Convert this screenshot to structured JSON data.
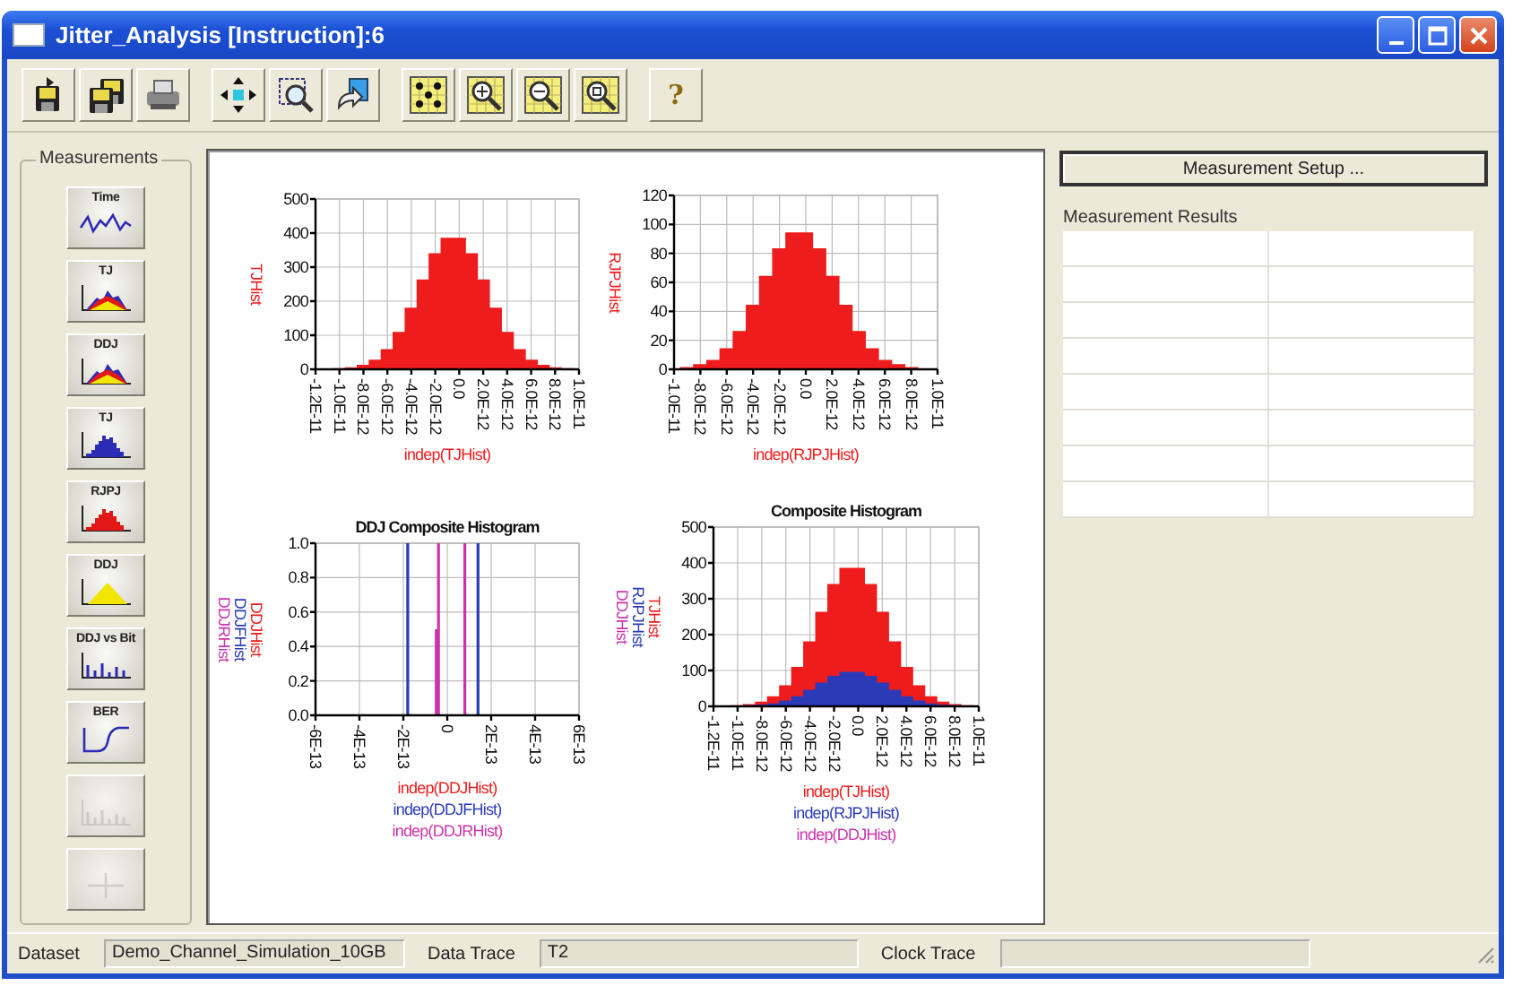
{
  "window": {
    "title": "Jitter_Analysis [Instruction]:6",
    "controls": [
      {
        "kind": "minimize"
      },
      {
        "kind": "maximize"
      },
      {
        "kind": "close"
      }
    ]
  },
  "toolbar": {
    "groups": [
      {
        "buttons": [
          {
            "kind": "save"
          },
          {
            "kind": "save-all"
          },
          {
            "kind": "print"
          }
        ]
      },
      {
        "buttons": [
          {
            "kind": "move"
          },
          {
            "kind": "zoom-box"
          },
          {
            "kind": "copy"
          }
        ]
      },
      {
        "buttons": [
          {
            "kind": "fit"
          },
          {
            "kind": "zoom-in"
          },
          {
            "kind": "zoom-out"
          },
          {
            "kind": "zoom-reset"
          }
        ]
      },
      {
        "buttons": [
          {
            "kind": "help",
            "glyph": "?"
          }
        ]
      }
    ]
  },
  "measurements": {
    "title": "Measurements",
    "buttons": [
      {
        "label": "Time",
        "kind": "waveform",
        "disabled": false
      },
      {
        "label": "TJ",
        "kind": "stacked-histogram",
        "disabled": false
      },
      {
        "label": "DDJ",
        "kind": "stacked-histogram",
        "disabled": false
      },
      {
        "label": "TJ",
        "kind": "histogram",
        "color": "#2b2bb5",
        "disabled": false
      },
      {
        "label": "RJPJ",
        "kind": "histogram",
        "color": "#e01818",
        "disabled": false
      },
      {
        "label": "DDJ",
        "kind": "triangle",
        "color": "#f2e600",
        "disabled": false
      },
      {
        "label": "DDJ vs Bit",
        "kind": "bit-bars",
        "disabled": false
      },
      {
        "label": "BER",
        "kind": "bathtub",
        "disabled": false
      },
      {
        "kind": "bit-bars",
        "disabled": true
      },
      {
        "kind": "plus",
        "disabled": true
      }
    ]
  },
  "charts": [
    {
      "chart_data": {
        "type": "area",
        "x": [
          -1.2e-11,
          -1.1e-11,
          -1e-11,
          -9e-12,
          -8e-12,
          -7e-12,
          -6e-12,
          -5e-12,
          -4e-12,
          -3e-12,
          -2e-12,
          -1e-12,
          0,
          1e-12,
          2e-12,
          3e-12,
          4e-12,
          5e-12,
          6e-12,
          7e-12,
          8e-12,
          9e-12,
          1e-11
        ],
        "grid": true,
        "xlabel": [
          "indep(TJHist)"
        ],
        "series": [
          {
            "name": "TJHist",
            "color": "#ee1c1c",
            "values": [
              0,
              0,
              1,
              4,
              11,
              26,
              57,
              108,
              179,
              262,
              339,
              384,
              384,
              339,
              262,
              179,
              108,
              57,
              26,
              11,
              4,
              1,
              0
            ]
          }
        ],
        "xlim": [
          -1.2e-11,
          1e-11
        ],
        "ylim": [
          0,
          500
        ],
        "yticks": [
          0,
          100,
          200,
          300,
          400,
          500
        ],
        "xticks": [
          {
            "value": -1.2e-11,
            "label": "-1.2E-11"
          },
          {
            "value": -1e-11,
            "label": "-1.0E-11"
          },
          {
            "value": -8e-12,
            "label": "-8.0E-12"
          },
          {
            "value": -6e-12,
            "label": "-6.0E-12"
          },
          {
            "value": -4e-12,
            "label": "-4.0E-12"
          },
          {
            "value": -2e-12,
            "label": "-2.0E-12"
          },
          {
            "value": 0,
            "label": "0.0"
          },
          {
            "value": 2e-12,
            "label": "2.0E-12"
          },
          {
            "value": 4e-12,
            "label": "4.0E-12"
          },
          {
            "value": 6e-12,
            "label": "6.0E-12"
          },
          {
            "value": 8e-12,
            "label": "8.0E-12"
          },
          {
            "value": 1e-11,
            "label": "1.0E-11"
          }
        ]
      }
    },
    {
      "chart_data": {
        "type": "area",
        "x": [
          -1e-11,
          -9e-12,
          -8e-12,
          -7e-12,
          -6e-12,
          -5e-12,
          -4e-12,
          -3e-12,
          -2e-12,
          -1e-12,
          0,
          1e-12,
          2e-12,
          3e-12,
          4e-12,
          5e-12,
          6e-12,
          7e-12,
          8e-12,
          9e-12,
          1e-11
        ],
        "grid": true,
        "xlabel": [
          "indep(RJPJHist)"
        ],
        "series": [
          {
            "name": "RJPJHist",
            "color": "#ee1c1c",
            "values": [
              0,
              1,
              3,
              6,
              14,
              26,
              44,
              64,
              83,
              94,
              94,
              83,
              64,
              44,
              26,
              14,
              6,
              3,
              1,
              0,
              0
            ]
          }
        ],
        "xlim": [
          -1e-11,
          1e-11
        ],
        "ylim": [
          0,
          120
        ],
        "yticks": [
          0,
          20,
          40,
          60,
          80,
          100,
          120
        ],
        "xticks": [
          {
            "value": -1e-11,
            "label": "-1.0E-11"
          },
          {
            "value": -8e-12,
            "label": "-8.0E-12"
          },
          {
            "value": -6e-12,
            "label": "-6.0E-12"
          },
          {
            "value": -4e-12,
            "label": "-4.0E-12"
          },
          {
            "value": -2e-12,
            "label": "-2.0E-12"
          },
          {
            "value": 0,
            "label": "0.0"
          },
          {
            "value": 2e-12,
            "label": "2.0E-12"
          },
          {
            "value": 4e-12,
            "label": "4.0E-12"
          },
          {
            "value": 6e-12,
            "label": "6.0E-12"
          },
          {
            "value": 8e-12,
            "label": "8.0E-12"
          },
          {
            "value": 1e-11,
            "label": "1.0E-11"
          }
        ]
      }
    },
    {
      "chart_data": {
        "type": "bar",
        "title": "DDJ Composite Histogram",
        "x": [
          -1.8e-13,
          -5e-14,
          -4e-14,
          8e-14,
          1.4e-13
        ],
        "grid": true,
        "xlabel": [
          "indep(DDJHist)",
          "indep(DDJFHist)",
          "indep(DDJRHist)"
        ],
        "series": [
          {
            "name": "DDJHist",
            "color": "#ee1c1c",
            "values": [
              null,
              null,
              null,
              null,
              null
            ]
          },
          {
            "name": "DDJFHist",
            "color": "#2b3bb8",
            "values": [
              1,
              null,
              null,
              null,
              1
            ]
          },
          {
            "name": "DDJRHist",
            "color": "#cc33aa",
            "values": [
              null,
              0.5,
              1,
              1,
              null
            ]
          }
        ],
        "xlim": [
          -6e-13,
          6e-13
        ],
        "ylim": [
          0,
          1
        ],
        "yticks": [
          {
            "value": 0,
            "label": "0.0"
          },
          {
            "value": 0.2,
            "label": "0.2"
          },
          {
            "value": 0.4,
            "label": "0.4"
          },
          {
            "value": 0.6,
            "label": "0.6"
          },
          {
            "value": 0.8,
            "label": "0.8"
          },
          {
            "value": 1,
            "label": "1.0"
          }
        ],
        "xticks": [
          {
            "value": -6e-13,
            "label": "-6E-13"
          },
          {
            "value": -4e-13,
            "label": "-4E-13"
          },
          {
            "value": -2e-13,
            "label": "-2E-13"
          },
          {
            "value": 0,
            "label": "0"
          },
          {
            "value": 2e-13,
            "label": "2E-13"
          },
          {
            "value": 4e-13,
            "label": "4E-13"
          },
          {
            "value": 6e-13,
            "label": "6E-13"
          }
        ]
      }
    },
    {
      "chart_data": {
        "type": "area",
        "title": "Composite Histogram",
        "x": [
          -1.2e-11,
          -1.1e-11,
          -1e-11,
          -9e-12,
          -8e-12,
          -7e-12,
          -6e-12,
          -5e-12,
          -4e-12,
          -3e-12,
          -2e-12,
          -1e-12,
          0,
          1e-12,
          2e-12,
          3e-12,
          4e-12,
          5e-12,
          6e-12,
          7e-12,
          8e-12,
          9e-12,
          1e-11
        ],
        "grid": true,
        "xlabel": [
          "indep(TJHist)",
          "indep(RJPJHist)",
          "indep(DDJHist)"
        ],
        "series": [
          {
            "name": "TJHist",
            "color": "#ee1c1c",
            "values": [
              0,
              0,
              1,
              4,
              11,
              26,
              57,
              108,
              179,
              262,
              339,
              384,
              384,
              339,
              262,
              179,
              108,
              57,
              26,
              11,
              4,
              1,
              0
            ]
          },
          {
            "name": "RJPJHist",
            "color": "#2b3bb8",
            "values": [
              0,
              0,
              0,
              1,
              3,
              6,
              14,
              26,
              44,
              64,
              83,
              94,
              94,
              83,
              64,
              44,
              26,
              14,
              6,
              3,
              1,
              0,
              0
            ]
          },
          {
            "name": "DDJHist",
            "color": "#cc33aa",
            "values": [
              null,
              null,
              null,
              null,
              null,
              null,
              null,
              null,
              null,
              null,
              null,
              null,
              null,
              null,
              null,
              null,
              null,
              null,
              null,
              null,
              null,
              null,
              null
            ]
          }
        ],
        "xlim": [
          -1.2e-11,
          1e-11
        ],
        "ylim": [
          0,
          500
        ],
        "yticks": [
          0,
          100,
          200,
          300,
          400,
          500
        ],
        "xticks": [
          {
            "value": -1.2e-11,
            "label": "-1.2E-11"
          },
          {
            "value": -1e-11,
            "label": "-1.0E-11"
          },
          {
            "value": -8e-12,
            "label": "-8.0E-12"
          },
          {
            "value": -6e-12,
            "label": "-6.0E-12"
          },
          {
            "value": -4e-12,
            "label": "-4.0E-12"
          },
          {
            "value": -2e-12,
            "label": "-2.0E-12"
          },
          {
            "value": 0,
            "label": "0.0"
          },
          {
            "value": 2e-12,
            "label": "2.0E-12"
          },
          {
            "value": 4e-12,
            "label": "4.0E-12"
          },
          {
            "value": 6e-12,
            "label": "6.0E-12"
          },
          {
            "value": 8e-12,
            "label": "8.0E-12"
          },
          {
            "value": 1e-11,
            "label": "1.0E-11"
          }
        ]
      }
    }
  ],
  "results_panel": {
    "setup_button": "Measurement Setup ...",
    "results_label": "Measurement Results"
  },
  "status_bar": {
    "fields": [
      {
        "label": "Dataset",
        "value": "Demo_Channel_Simulation_10GB"
      },
      {
        "label": "Data Trace",
        "value": "T2"
      },
      {
        "label": "Clock Trace"
      }
    ]
  }
}
